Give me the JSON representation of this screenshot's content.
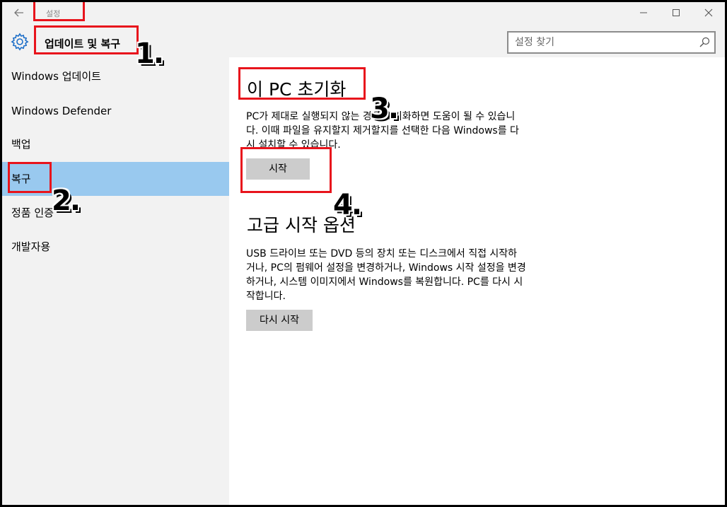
{
  "window": {
    "title": "설정",
    "section_title": "업데이트 및 복구"
  },
  "search": {
    "placeholder": "설정 찾기"
  },
  "sidebar": {
    "items": [
      {
        "label": "Windows 업데이트"
      },
      {
        "label": "Windows Defender"
      },
      {
        "label": "백업"
      },
      {
        "label": "복구"
      },
      {
        "label": "정품 인증"
      },
      {
        "label": "개발자용"
      }
    ],
    "active": "복구"
  },
  "reset": {
    "title": "이 PC 초기화",
    "description_line1": "PC가 제대로 실행되지 않는 경우 초기화하면 도움이 될 수 있습니",
    "description_line2": "다. 이때 파일을 유지할지 제거할지를 선택한 다음 Windows를 다",
    "description_line3": "시 설치할 수 있습니다.",
    "button": "시작"
  },
  "advanced": {
    "title": "고급 시작 옵션",
    "description_line1": "USB 드라이브 또는 DVD 등의 장치 또는 디스크에서 직접 시작하",
    "description_line2": "거나, PC의 펌웨어 설정을 변경하거나, Windows 시작 설정을 변경",
    "description_line3": "하거나, 시스템 이미지에서 Windows를 복원합니다. PC를 다시 시",
    "description_line4": "작합니다.",
    "button": "다시 시작"
  },
  "annotations": {
    "step1": "1.",
    "step2": "2.",
    "step3": "3.",
    "step4": "4."
  },
  "colors": {
    "active_nav": "#99c9ef",
    "annotation_red": "#e8141c",
    "gear_blue": "#1e6fc8"
  }
}
